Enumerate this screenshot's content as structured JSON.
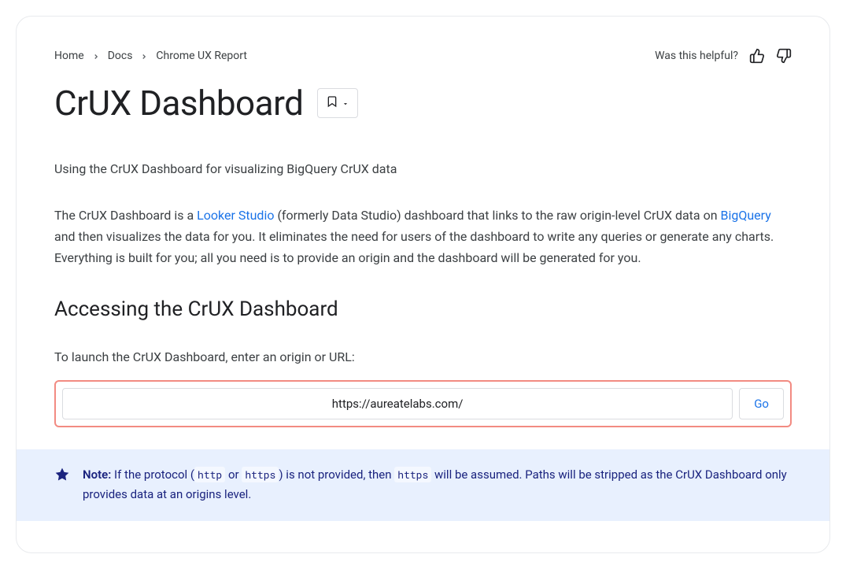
{
  "breadcrumbs": {
    "items": [
      "Home",
      "Docs",
      "Chrome UX Report"
    ]
  },
  "helpful": {
    "text": "Was this helpful?"
  },
  "title": "CrUX Dashboard",
  "subtitle": "Using the CrUX Dashboard for visualizing BigQuery CrUX data",
  "intro": {
    "part1": "The CrUX Dashboard is a ",
    "link1": "Looker Studio",
    "part2": " (formerly Data Studio) dashboard that links to the raw origin-level CrUX data on ",
    "link2": "BigQuery",
    "part3": " and then visualizes the data for you. It eliminates the need for users of the dashboard to write any queries or generate any charts. Everything is built for you; all you need is to provide an origin and the dashboard will be generated for you."
  },
  "section_heading": "Accessing the CrUX Dashboard",
  "launch_text": "To launch the CrUX Dashboard, enter an origin or URL:",
  "url_input": {
    "value": "https://aureatelabs.com/"
  },
  "go_button": "Go",
  "note": {
    "label": "Note:",
    "part1": " If the protocol (",
    "code1": "http",
    "part2": " or ",
    "code2": "https",
    "part3": ") is not provided, then ",
    "code3": "https",
    "part4": " will be assumed. Paths will be stripped as the CrUX Dashboard only provides data at an origins level."
  }
}
